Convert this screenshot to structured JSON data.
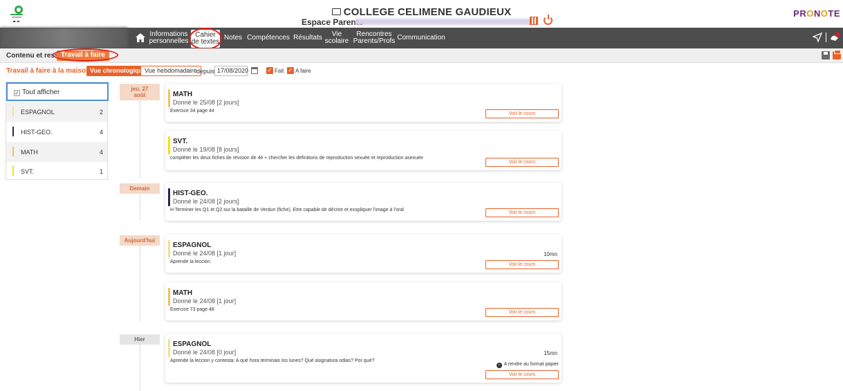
{
  "header": {
    "school_name": "COLLEGE CELIMENE GAUDIEUX",
    "espace_label": "Espace Parents -",
    "brand": "PRONOTE"
  },
  "nav": {
    "items": [
      {
        "label_line1": "Informations",
        "label_line2": "personnelles"
      },
      {
        "label_line1": "Cahier",
        "label_line2": "de textes"
      },
      {
        "label_line1": "Notes",
        "label_line2": ""
      },
      {
        "label_line1": "Compétences",
        "label_line2": ""
      },
      {
        "label_line1": "Résultats",
        "label_line2": ""
      },
      {
        "label_line1": "Vie",
        "label_line2": "scolaire"
      },
      {
        "label_line1": "Rencontres",
        "label_line2": "Parents/Profs"
      },
      {
        "label_line1": "Communication",
        "label_line2": ""
      }
    ],
    "active_index": 1
  },
  "subnav": {
    "contenu": "Contenu et ressources",
    "travail": "Travail à faire"
  },
  "options": {
    "title": "Travail à faire à la maison",
    "chrono": "Vue chronologique",
    "hebdo": "Vue hebdomadaire",
    "depuis": "depuis",
    "date": "17/08/2020",
    "fait": "Fait",
    "a_faire": "A faire"
  },
  "filters": {
    "all_label": "Tout afficher",
    "subjects": [
      {
        "name": "ESPAGNOL",
        "count": "2",
        "color": "#f5e08a"
      },
      {
        "name": "HIST-GEO.",
        "count": "4",
        "color": "#1f2a55"
      },
      {
        "name": "MATH",
        "count": "4",
        "color": "#f2c062"
      },
      {
        "name": "SVT.",
        "count": "1",
        "color": "#f5e300"
      }
    ]
  },
  "timeline": {
    "dates": [
      {
        "line1": "jeu. 27",
        "line2": "août"
      },
      {
        "line1": "Demain",
        "line2": ""
      },
      {
        "line1": "Aujourd'hui",
        "line2": ""
      },
      {
        "line1": "Hier",
        "line2": ""
      }
    ],
    "cards": [
      {
        "subject": "MATH",
        "given": "Donné le 25/08 [2 jours]",
        "desc": "Exercice 34 page 44",
        "duration": "",
        "paper": "",
        "voir": "Voir le cours",
        "color": "#f2c062"
      },
      {
        "subject": "SVT.",
        "given": "Donné le 19/08 [8 jours]",
        "desc": "compléter les deux fiches de révision de 4è + chercher les définitions de reproduction sexuée et reproduction asexuée",
        "duration": "",
        "paper": "",
        "voir": "Voir le cours",
        "color": "#f5e300"
      },
      {
        "subject": "HIST-GEO.",
        "given": "Donné le 24/08 [2 jours]",
        "desc": "H Terminer les Q1 et Q2 sur la bataille de Verdun (fiche). Etre capable de décrire et exxpliquer l'image à l'oral",
        "duration": "",
        "paper": "",
        "voir": "Voir le cours",
        "color": "#1f2a55"
      },
      {
        "subject": "ESPAGNOL",
        "given": "Donné le 24/08 [1 jour]",
        "desc": "Aprende la lección.",
        "duration": "10mn",
        "paper": "",
        "voir": "Voir le cours",
        "color": "#f5e08a"
      },
      {
        "subject": "MATH",
        "given": "Donné le 24/08 [1 jour]",
        "desc": "Exercice 73 page 48",
        "duration": "",
        "paper": "",
        "voir": "Voir le cours",
        "color": "#f2c062"
      },
      {
        "subject": "ESPAGNOL",
        "given": "Donné le 24/08 [0 jour]",
        "desc": "Aprende la leccion y contesta: A qué hora terminais los lunes? Qué asignatura odias? Por qué?",
        "duration": "15mn",
        "paper": "A rendre au format papier",
        "voir": "Voir le cours",
        "color": "#f5e08a"
      }
    ]
  }
}
